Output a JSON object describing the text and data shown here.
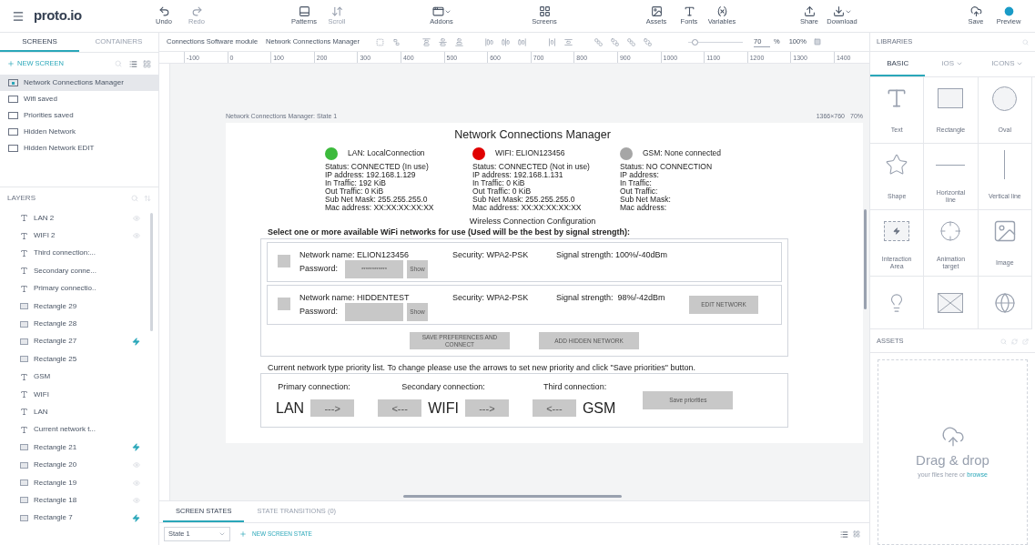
{
  "topbar": {
    "logo": "proto.io",
    "groups": [
      [
        {
          "label": "Undo",
          "disabled": false,
          "menu": false
        },
        {
          "label": "Redo",
          "disabled": true,
          "menu": false
        }
      ],
      [
        {
          "label": "Patterns",
          "disabled": false,
          "menu": false
        },
        {
          "label": "Scroll",
          "disabled": true,
          "menu": false
        }
      ],
      [
        {
          "label": "Addons",
          "disabled": false,
          "menu": true
        }
      ],
      [
        {
          "label": "Screens",
          "disabled": false,
          "menu": false
        }
      ],
      [
        {
          "label": "Assets",
          "disabled": false,
          "menu": false
        },
        {
          "label": "Fonts",
          "disabled": false,
          "menu": false
        },
        {
          "label": "Variables",
          "disabled": false,
          "menu": false
        }
      ],
      [
        {
          "label": "Share",
          "disabled": false,
          "menu": false
        },
        {
          "label": "Download",
          "disabled": false,
          "menu": true
        }
      ],
      [
        {
          "label": "Save",
          "disabled": false,
          "menu": false
        },
        {
          "label": "Preview",
          "disabled": false,
          "menu": false
        }
      ]
    ]
  },
  "sidebar": {
    "tabs": [
      {
        "label": "SCREENS",
        "selected": true
      },
      {
        "label": "CONTAINERS",
        "selected": false
      }
    ],
    "new_screen": "NEW SCREEN",
    "screens": [
      {
        "label": "Network Connections Manager",
        "selected": true
      },
      {
        "label": "Wifi saved",
        "selected": false
      },
      {
        "label": "Priorities saved",
        "selected": false
      },
      {
        "label": "Hidden Network",
        "selected": false
      },
      {
        "label": "Hidden Network EDIT",
        "selected": false
      }
    ],
    "layers_title": "LAYERS",
    "layers": [
      {
        "kind": "text",
        "label": "LAN 2",
        "hidden": true,
        "interaction": false
      },
      {
        "kind": "text",
        "label": "WIFI 2",
        "hidden": true,
        "interaction": false
      },
      {
        "kind": "text",
        "label": "Third connection:...",
        "hidden": false,
        "interaction": false
      },
      {
        "kind": "text",
        "label": "Secondary conne...",
        "hidden": false,
        "interaction": false
      },
      {
        "kind": "text",
        "label": "Primary connectio..",
        "hidden": false,
        "interaction": false
      },
      {
        "kind": "rect",
        "label": "Rectangle 29",
        "hidden": false,
        "interaction": false
      },
      {
        "kind": "rect",
        "label": "Rectangle 28",
        "hidden": false,
        "interaction": false
      },
      {
        "kind": "rect",
        "label": "Rectangle 27",
        "hidden": false,
        "interaction": true
      },
      {
        "kind": "rect",
        "label": "Rectangle 25",
        "hidden": false,
        "interaction": false
      },
      {
        "kind": "text",
        "label": "GSM",
        "hidden": false,
        "interaction": false
      },
      {
        "kind": "text",
        "label": "WIFI",
        "hidden": false,
        "interaction": false
      },
      {
        "kind": "text",
        "label": "LAN",
        "hidden": false,
        "interaction": false
      },
      {
        "kind": "text",
        "label": "Current network t...",
        "hidden": false,
        "interaction": false
      },
      {
        "kind": "rect",
        "label": "Rectangle 21",
        "hidden": false,
        "interaction": true
      },
      {
        "kind": "rect",
        "label": "Rectangle 20",
        "hidden": true,
        "interaction": false
      },
      {
        "kind": "rect",
        "label": "Rectangle 19",
        "hidden": true,
        "interaction": false
      },
      {
        "kind": "rect",
        "label": "Rectangle 18",
        "hidden": true,
        "interaction": false
      },
      {
        "kind": "rect",
        "label": "Rectangle 7",
        "hidden": false,
        "interaction": true
      }
    ]
  },
  "editor": {
    "breadcrumb": [
      "Connections Software module",
      "Network Connections Manager"
    ],
    "zoom": {
      "level": 0.12,
      "value": "70",
      "unit": "%",
      "reset": "100%"
    },
    "ruler": [
      "-100",
      "0",
      "100",
      "200",
      "300",
      "400",
      "500",
      "600",
      "700",
      "800",
      "900",
      "1000",
      "1100",
      "1200",
      "1300",
      "1400"
    ],
    "canvas_label": "Network Connections Manager: State 1",
    "canvas_size": "1366×760",
    "canvas_zoom": "70%"
  },
  "mockup": {
    "title": "Network Connections Manager",
    "connections": [
      {
        "color": "#3cba3c",
        "name": "LAN: LocalConnection",
        "details": [
          "Status: CONNECTED (In use)",
          "IP address: 192.168.1.129",
          "In Traffic: 192 KiB",
          "Out Traffic: 0 KiB",
          "Sub Net Mask: 255.255.255.0",
          "Mac address: XX:XX:XX:XX:XX"
        ]
      },
      {
        "color": "#e00000",
        "name": "WIFI: ELION123456",
        "details": [
          "Status: CONNECTED (Not in use)",
          "IP address: 192.168.1.131",
          "In Traffic: 0 KiB",
          "Out Traffic: 0 KiB",
          "Sub Net Mask: 255.255.255.0",
          "Mac address: XX:XX:XX:XX:XX"
        ]
      },
      {
        "color": "#a6a6a6",
        "name": "GSM: None connected",
        "details": [
          "Status: NO CONNECTION",
          "IP address:",
          "In Traffic:",
          "Out Traffic:",
          "Sub Net Mask:",
          "Mac address:"
        ]
      }
    ],
    "wireless_title": "Wireless Connection Configuration",
    "wireless_hint": "Select one or more available WiFi networks for use (Used will be the best by signal strength):",
    "networks": [
      {
        "checked": false,
        "name": "Network name: ELION123456",
        "password_label": "Password:",
        "password": "************",
        "show": "Show",
        "security": "Security: WPA2-PSK",
        "signal": "Signal strength: 100%/-40dBm"
      },
      {
        "checked": false,
        "name": "Network name: HIDDENTEST",
        "password_label": "Password:",
        "show": "Show",
        "security": "Security: WPA2-PSK",
        "signal": "Signal strength:  98%/-42dBm",
        "action": "EDIT NETWORK"
      }
    ],
    "buttons": [
      "SAVE PREFERENCES AND CONNECT",
      "ADD HIDDEN NETWORK"
    ],
    "priority_hint": "Current network type priority list. To change please use the arrows to set new priority and click \"Save priorities\" button.",
    "priorities": [
      {
        "label": "Primary connection:",
        "value": "LAN",
        "forward": "--->"
      },
      {
        "label": "Secondary connection:",
        "value": "WIFI",
        "back": "<---",
        "forward": "--->"
      },
      {
        "label": "Third connection:",
        "value": "GSM",
        "back": "<---"
      }
    ],
    "save_priorities": "Save priorities"
  },
  "libraries": {
    "title": "LIBRARIES",
    "tabs": [
      {
        "label": "BASIC",
        "selected": true,
        "menu": false
      },
      {
        "label": "iOS",
        "selected": false,
        "menu": true
      },
      {
        "label": "ICONS",
        "selected": false,
        "menu": true
      }
    ],
    "items": [
      {
        "label": "Text"
      },
      {
        "label": "Rectangle"
      },
      {
        "label": "Oval"
      },
      {
        "label": "Shape"
      },
      {
        "label": "Horizontal line"
      },
      {
        "label": "Vertical line"
      },
      {
        "label": "Interaction Area"
      },
      {
        "label": "Animation target"
      },
      {
        "label": "Image"
      }
    ]
  },
  "assets": {
    "title": "ASSETS",
    "drop_title": "Drag & drop",
    "drop_hint": "your files here or",
    "drop_link": "browse"
  },
  "bottom": {
    "tabs": [
      {
        "label": "SCREEN STATES",
        "selected": true
      },
      {
        "label": "STATE TRANSITIONS (0)",
        "selected": false
      }
    ],
    "state": "State 1",
    "new_state": "NEW SCREEN STATE"
  }
}
